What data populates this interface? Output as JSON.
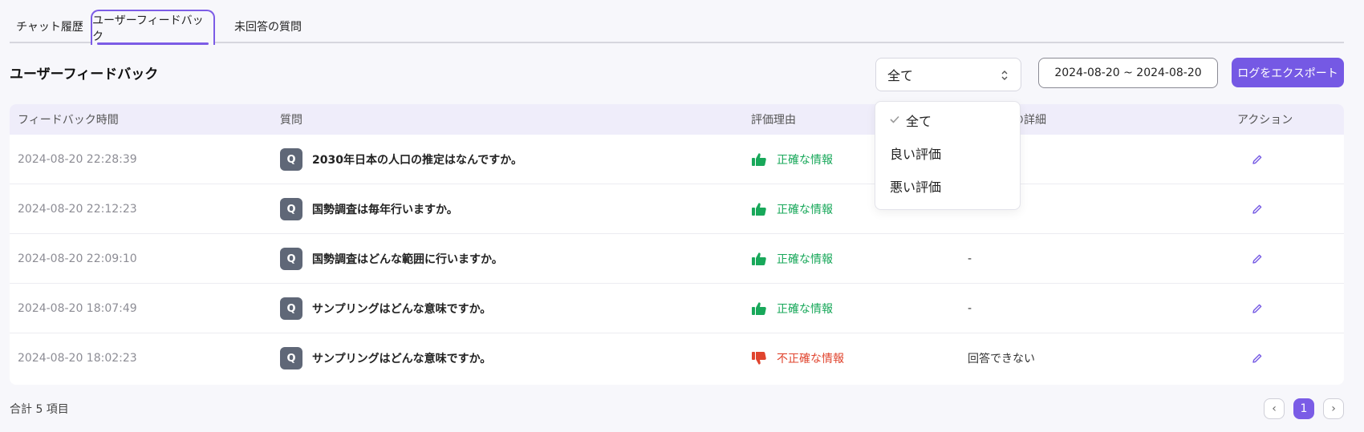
{
  "tabs": [
    {
      "label": "チャット履歴"
    },
    {
      "label": "ユーザーフィードバック"
    },
    {
      "label": "未回答の質問"
    }
  ],
  "page_title": "ユーザーフィードバック",
  "filter": {
    "selected": "全て",
    "options": [
      "全て",
      "良い評価",
      "悪い評価"
    ]
  },
  "date_range": "2024-08-20 ~ 2024-08-20",
  "export_label": "ログをエクスポート",
  "table": {
    "headers": [
      "フィードバック時間",
      "質問",
      "評価理由",
      "フィードバックの詳細",
      "アクション"
    ],
    "header_detail_visible": "ドバックの詳細",
    "rows": [
      {
        "time": "2024-08-20 22:28:39",
        "badge": "Q",
        "question": "2030年日本の人口の推定はなんですか。",
        "reason": "正確な情報",
        "rating": "good",
        "detail": ""
      },
      {
        "time": "2024-08-20 22:12:23",
        "badge": "Q",
        "question": "国勢調査は毎年行いますか。",
        "reason": "正確な情報",
        "rating": "good",
        "detail": ""
      },
      {
        "time": "2024-08-20 22:09:10",
        "badge": "Q",
        "question": "国勢調査はどんな範囲に行いますか。",
        "reason": "正確な情報",
        "rating": "good",
        "detail": "-"
      },
      {
        "time": "2024-08-20 18:07:49",
        "badge": "Q",
        "question": "サンプリングはどんな意味ですか。",
        "reason": "正確な情報",
        "rating": "good",
        "detail": "-"
      },
      {
        "time": "2024-08-20 18:02:23",
        "badge": "Q",
        "question": "サンプリングはどんな意味ですか。",
        "reason": "不正確な情報",
        "rating": "bad",
        "detail": "回答できない"
      }
    ]
  },
  "footer": {
    "total": "合計 5 項目",
    "pager": {
      "prev": "‹",
      "current": "1",
      "next": "›"
    }
  },
  "colors": {
    "accent": "#7559e4",
    "good": "#18a85a",
    "bad": "#e0442e",
    "header_bg": "#efedfa"
  },
  "icons": {
    "good": "thumbs-up-icon",
    "bad": "thumbs-down-icon",
    "edit": "pencil-icon",
    "check": "check-icon",
    "select": "chevron-updown-icon"
  }
}
